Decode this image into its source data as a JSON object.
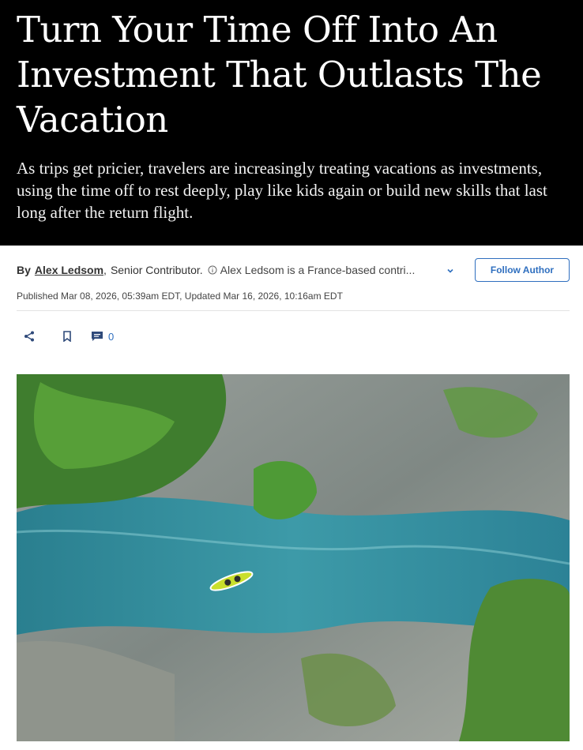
{
  "article": {
    "headline": "Turn Your Time Off Into An Investment That Outlasts The Vacation",
    "dek": "As trips get pricier, travelers are increasingly treating vacations as investments, using the time off to rest deeply, play like kids again or build new skills that last long after the return flight."
  },
  "byline": {
    "by_label": "By",
    "author_name": "Alex Ledsom",
    "comma": ",",
    "author_title": "Senior Contributor.",
    "author_bio": "Alex Ledsom is a France-based contri...",
    "follow_label": "Follow Author"
  },
  "dates": {
    "text": "Published Mar 08, 2026, 05:39am EDT, Updated Mar 16, 2026, 10:16am EDT"
  },
  "actions": {
    "comment_count": "0"
  },
  "icons": {
    "info": "info-icon",
    "expand": "chevron-down-icon",
    "share": "share-icon",
    "bookmark": "bookmark-icon",
    "comment": "comment-icon"
  },
  "colors": {
    "hero_background": "#000000",
    "accent_blue": "#2f6fbf",
    "water": "#3d9aa8"
  }
}
